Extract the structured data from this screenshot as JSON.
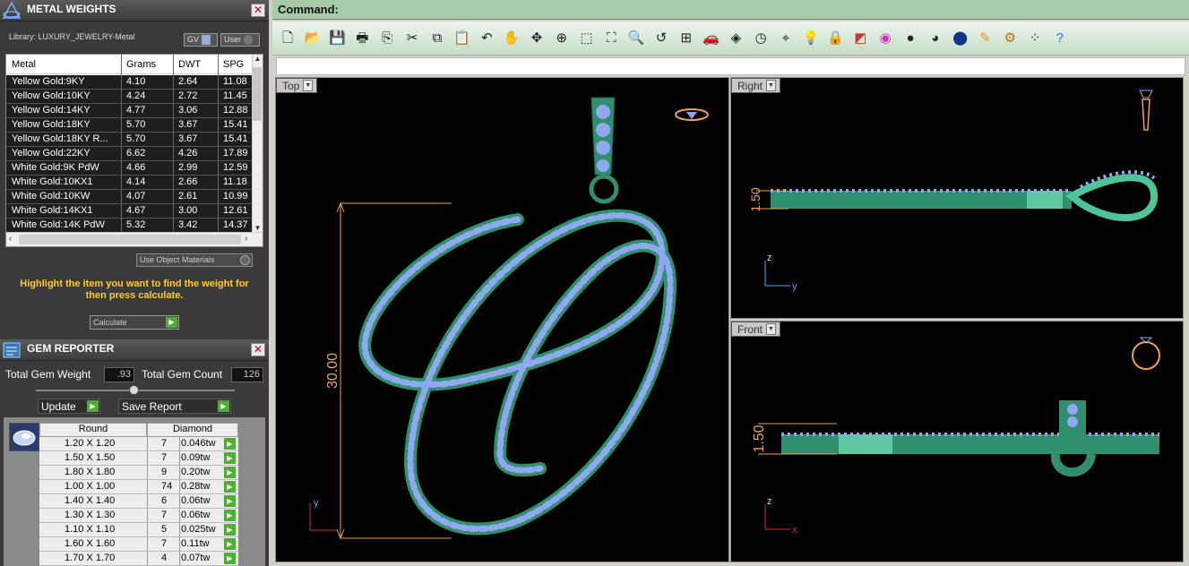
{
  "metal_weights": {
    "title": "METAL WEIGHTS",
    "library_label": "Library: LUXURY_JEWELRY-Metal",
    "toggle_gv": "GV",
    "toggle_user": "User",
    "columns": [
      "Metal",
      "Grams",
      "DWT",
      "SPG"
    ],
    "rows": [
      {
        "metal": "Yellow Gold:9KY",
        "grams": "4.10",
        "dwt": "2.64",
        "spg": "11.08"
      },
      {
        "metal": "Yellow Gold:10KY",
        "grams": "4.24",
        "dwt": "2.72",
        "spg": "11.45"
      },
      {
        "metal": "Yellow Gold:14KY",
        "grams": "4.77",
        "dwt": "3.06",
        "spg": "12.88"
      },
      {
        "metal": "Yellow Gold:18KY",
        "grams": "5.70",
        "dwt": "3.67",
        "spg": "15.41"
      },
      {
        "metal": "Yellow Gold:18KY R...",
        "grams": "5.70",
        "dwt": "3.67",
        "spg": "15.41"
      },
      {
        "metal": "Yellow Gold:22KY",
        "grams": "6.62",
        "dwt": "4.26",
        "spg": "17.89"
      },
      {
        "metal": "White Gold:9K PdW",
        "grams": "4.66",
        "dwt": "2.99",
        "spg": "12.59"
      },
      {
        "metal": "White Gold:10KX1",
        "grams": "4.14",
        "dwt": "2.66",
        "spg": "11.18"
      },
      {
        "metal": "White Gold:10KW",
        "grams": "4.07",
        "dwt": "2.61",
        "spg": "10.99"
      },
      {
        "metal": "White Gold:14KX1",
        "grams": "4.67",
        "dwt": "3.00",
        "spg": "12.61"
      },
      {
        "metal": "White Gold:14K PdW",
        "grams": "5.32",
        "dwt": "3.42",
        "spg": "14.37"
      }
    ],
    "use_object_materials": "Use Object Materials",
    "hint": "Highlight the item you want to find the weight for then press calculate.",
    "calculate_label": "Calculate"
  },
  "gem_reporter": {
    "title": "GEM REPORTER",
    "total_weight_label": "Total Gem Weight",
    "total_weight_value": ".93",
    "total_count_label": "Total Gem Count",
    "total_count_value": "126",
    "update_label": "Update",
    "save_report_label": "Save Report",
    "header_shape": "Round",
    "header_stone": "Diamond",
    "rows": [
      {
        "size": "1.20 X 1.20",
        "count": "7",
        "weight": "0.046tw"
      },
      {
        "size": "1.50 X 1.50",
        "count": "7",
        "weight": "0.09tw"
      },
      {
        "size": "1.80 X 1.80",
        "count": "9",
        "weight": "0.20tw"
      },
      {
        "size": "1.00 X 1.00",
        "count": "74",
        "weight": "0.28tw"
      },
      {
        "size": "1.40 X 1.40",
        "count": "6",
        "weight": "0.06tw"
      },
      {
        "size": "1.30 X 1.30",
        "count": "7",
        "weight": "0.06tw"
      },
      {
        "size": "1.10 X 1.10",
        "count": "5",
        "weight": "0.025tw"
      },
      {
        "size": "1.60 X 1.60",
        "count": "7",
        "weight": "0.11tw"
      },
      {
        "size": "1.70 X 1.70",
        "count": "4",
        "weight": "0.07tw"
      }
    ]
  },
  "command": {
    "label": "Command:"
  },
  "toolbar_icons": [
    "new-file",
    "open-folder",
    "save",
    "print",
    "export",
    "cut",
    "copy",
    "paste",
    "undo",
    "pan-hand",
    "rotate-view",
    "zoom-in",
    "zoom-window",
    "zoom-extents",
    "zoom-selected",
    "undo-view",
    "four-viewports",
    "car",
    "camera",
    "clock",
    "snap",
    "light-bulb",
    "lock",
    "layer",
    "color-wheel",
    "render-sphere",
    "shaded-sphere",
    "blue-sphere",
    "pen",
    "gear",
    "select-points",
    "help"
  ],
  "viewports": {
    "top": {
      "label": "Top",
      "dimension": "30.00",
      "axis": "y"
    },
    "right": {
      "label": "Right",
      "dimension": "1.50",
      "axis_v": "z",
      "axis_h": "y"
    },
    "front": {
      "label": "Front",
      "dimension": "1.50",
      "axis_v": "z",
      "axis_h": "x"
    }
  },
  "colors": {
    "metal": "#2f8f6f",
    "gem": "#8fa8f0",
    "dim_line": "#f0a050",
    "cmd_bar": "#a6cba6"
  }
}
